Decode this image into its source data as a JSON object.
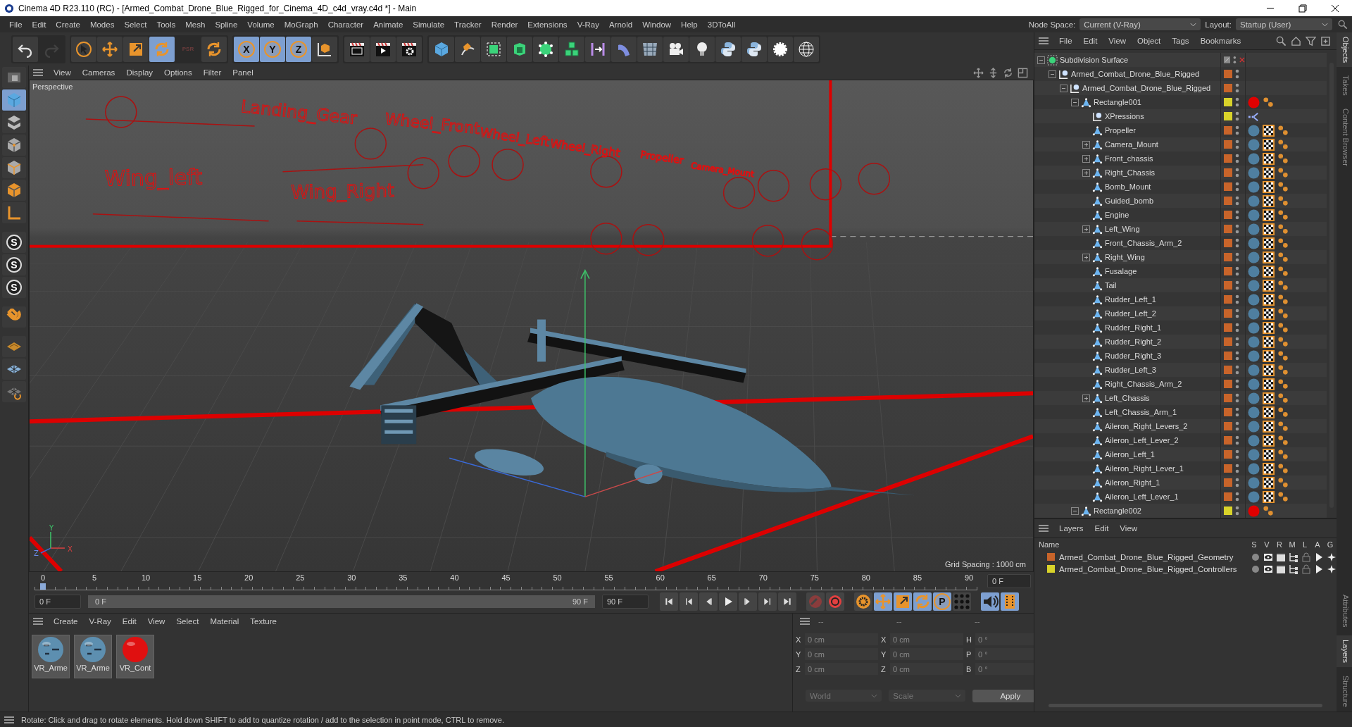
{
  "window": {
    "title": "Cinema 4D R23.110 (RC) - [Armed_Combat_Drone_Blue_Rigged_for_Cinema_4D_c4d_vray.c4d *] - Main"
  },
  "menu": [
    "File",
    "Edit",
    "Create",
    "Modes",
    "Select",
    "Tools",
    "Mesh",
    "Spline",
    "Volume",
    "MoGraph",
    "Character",
    "Animate",
    "Simulate",
    "Tracker",
    "Render",
    "Extensions",
    "V-Ray",
    "Arnold",
    "Window",
    "Help",
    "3DToAll"
  ],
  "node_space": {
    "label": "Node Space:",
    "value": "Current (V-Ray)"
  },
  "layout": {
    "label": "Layout:",
    "value": "Startup (User)"
  },
  "toolbar": [
    [
      {
        "kind": "undo",
        "selected": false,
        "disabled": false
      },
      {
        "kind": "redo",
        "selected": false,
        "disabled": true
      }
    ],
    [
      {
        "kind": "cursor",
        "selected": false,
        "disabled": false
      },
      {
        "kind": "move",
        "selected": false,
        "disabled": false
      },
      {
        "kind": "scale",
        "selected": false,
        "disabled": false
      },
      {
        "kind": "rotate",
        "selected": true,
        "disabled": false
      },
      {
        "kind": "psr",
        "label": "PSR",
        "selected": false,
        "disabled": true
      },
      {
        "kind": "rotate",
        "selected": false,
        "disabled": false
      }
    ],
    [
      {
        "kind": "letter",
        "label": "X",
        "selected": true,
        "disabled": false
      },
      {
        "kind": "letter",
        "label": "Y",
        "selected": true,
        "disabled": false
      },
      {
        "kind": "letter",
        "label": "Z",
        "selected": true,
        "disabled": false
      },
      {
        "kind": "coordinate-system",
        "selected": false,
        "disabled": false
      }
    ],
    [
      {
        "kind": "render-view",
        "selected": false,
        "disabled": false
      },
      {
        "kind": "render",
        "selected": false,
        "disabled": false
      },
      {
        "kind": "render-settings",
        "selected": false,
        "disabled": false
      }
    ],
    [
      {
        "kind": "cube",
        "selected": false,
        "disabled": false
      },
      {
        "kind": "pen",
        "selected": false,
        "disabled": false
      },
      {
        "kind": "subdivision",
        "selected": false,
        "disabled": false
      },
      {
        "kind": "extrude",
        "selected": false,
        "disabled": false
      },
      {
        "kind": "polygon-object",
        "selected": false,
        "disabled": false
      },
      {
        "kind": "cloner",
        "selected": false,
        "disabled": false
      },
      {
        "kind": "symmetry",
        "selected": false,
        "disabled": false
      },
      {
        "kind": "bend",
        "selected": false,
        "disabled": false
      },
      {
        "kind": "floor",
        "selected": false,
        "disabled": false
      },
      {
        "kind": "camera",
        "selected": false,
        "disabled": false
      },
      {
        "kind": "light",
        "selected": false,
        "disabled": false
      },
      {
        "kind": "python",
        "selected": false,
        "disabled": false
      },
      {
        "kind": "python",
        "selected": false,
        "disabled": false
      },
      {
        "kind": "gear",
        "selected": false,
        "disabled": false
      },
      {
        "kind": "globe",
        "selected": false,
        "disabled": false
      }
    ]
  ],
  "tools": [
    {
      "kind": "viewport-solo",
      "selected": false
    },
    {
      "kind": "cube",
      "selected": true
    },
    {
      "kind": "checker",
      "selected": false
    },
    {
      "kind": "points",
      "selected": false
    },
    {
      "kind": "edges",
      "selected": false
    },
    {
      "kind": "polygons",
      "selected": false
    },
    {
      "kind": "axis",
      "selected": false
    },
    {
      "kind": "letter",
      "label": "S",
      "selected": false
    },
    {
      "kind": "letter",
      "label": "S",
      "selected": false
    },
    {
      "kind": "letter",
      "label": "S",
      "selected": false
    },
    {
      "kind": "magnet",
      "selected": false
    },
    {
      "kind": "workplane",
      "selected": false
    },
    {
      "kind": "grid",
      "selected": false
    },
    {
      "kind": "grid-snap",
      "selected": false
    }
  ],
  "viewport": {
    "menu": [
      "View",
      "Cameras",
      "Display",
      "Options",
      "Filter",
      "Panel"
    ],
    "camera": "Perspective",
    "grid_spacing": "Grid Spacing : 1000 cm",
    "scene_labels": [
      "Wing_left",
      "Wing_Right",
      "Landing_Gear",
      "Wheel_Front",
      "Wheel_Left",
      "Wheel_Right",
      "Propeller",
      "Camera_Mount"
    ],
    "axis_labels": [
      "Y",
      "Z",
      "X"
    ]
  },
  "timeline": {
    "ticks": [
      "0",
      "5",
      "10",
      "15",
      "20",
      "25",
      "30",
      "35",
      "40",
      "45",
      "50",
      "55",
      "60",
      "65",
      "70",
      "75",
      "80",
      "85",
      "90"
    ],
    "playhead": {
      "level": 0
    },
    "current_frame": "0 F",
    "start_field": "0 F",
    "range": {
      "start": "0 F",
      "end": "90 F",
      "level": 1
    },
    "end_field": "90 F"
  },
  "transport": [
    {
      "kind": "first-frame",
      "selected": false
    },
    {
      "kind": "prev-key",
      "selected": false
    },
    {
      "kind": "prev-frame",
      "selected": false
    },
    {
      "kind": "play",
      "selected": false
    },
    {
      "kind": "next-frame",
      "selected": false
    },
    {
      "kind": "next-key",
      "selected": false
    },
    {
      "kind": "last-frame",
      "selected": false
    },
    {
      "kind": "record",
      "selected": false
    },
    {
      "kind": "autokey",
      "selected": false
    },
    {
      "kind": "key-settings",
      "selected": false
    },
    {
      "kind": "move",
      "selected": true
    },
    {
      "kind": "scale",
      "selected": true
    },
    {
      "kind": "rotate",
      "selected": true
    },
    {
      "kind": "letter",
      "label": "P",
      "selected": true
    },
    {
      "kind": "dots",
      "selected": false
    },
    {
      "kind": "sound",
      "selected": true
    },
    {
      "kind": "film",
      "selected": true
    }
  ],
  "materials": {
    "menu": [
      "Create",
      "V-Ray",
      "Edit",
      "View",
      "Select",
      "Material",
      "Texture"
    ],
    "items": [
      {
        "name": "VR_Arme",
        "kind": "blue"
      },
      {
        "name": "VR_Arme",
        "kind": "blue"
      },
      {
        "name": "VR_Cont",
        "kind": "red"
      }
    ]
  },
  "coordinates": {
    "headers": [
      "--",
      "--",
      "--"
    ],
    "columns": [
      [
        {
          "label": "X",
          "placeholder": "0 cm"
        },
        {
          "label": "Y",
          "placeholder": "0 cm"
        },
        {
          "label": "Z",
          "placeholder": "0 cm"
        }
      ],
      [
        {
          "label": "X",
          "placeholder": "0 cm"
        },
        {
          "label": "Y",
          "placeholder": "0 cm"
        },
        {
          "label": "Z",
          "placeholder": "0 cm"
        }
      ],
      [
        {
          "label": "H",
          "placeholder": "0 °"
        },
        {
          "label": "P",
          "placeholder": "0 °"
        },
        {
          "label": "B",
          "placeholder": "0 °"
        }
      ]
    ],
    "dropdowns": [
      "World",
      "Scale"
    ],
    "apply": "Apply"
  },
  "objects_menu": [
    "File",
    "Edit",
    "View",
    "Object",
    "Tags",
    "Bookmarks"
  ],
  "objects": [
    {
      "name": "Subdivision Surface",
      "kind": "subdivision",
      "expanded": true,
      "children": [
        {
          "name": "Armed_Combat_Drone_Blue_Rigged",
          "kind": "null",
          "color": "#c8642a",
          "expanded": true,
          "children": [
            {
              "name": "Armed_Combat_Drone_Blue_Rigged",
              "kind": "null",
              "color": "#c8642a",
              "expanded": true,
              "children": [
                {
                  "name": "Rectangle001",
                  "kind": "joint",
                  "color": "#d9d32a",
                  "expanded": true,
                  "tags": [
                    {
                      "kind": "material",
                      "color": "#e00000"
                    },
                    {
                      "kind": "weight"
                    }
                  ],
                  "children": [
                    {
                      "name": "XPressions",
                      "kind": "null",
                      "color": "#d9d32a",
                      "tags": [
                        {
                          "kind": "xpresso"
                        }
                      ]
                    },
                    {
                      "name": "Propeller",
                      "kind": "joint",
                      "color": "#c8642a",
                      "tags": [
                        {
                          "kind": "material",
                          "color": "#4f7fa0"
                        },
                        {
                          "kind": "texture"
                        },
                        {
                          "kind": "weight"
                        }
                      ]
                    },
                    {
                      "name": "Camera_Mount",
                      "kind": "joint",
                      "color": "#c8642a",
                      "expanded": false,
                      "tags": [
                        {
                          "kind": "material",
                          "color": "#4f7fa0"
                        },
                        {
                          "kind": "texture"
                        },
                        {
                          "kind": "weight"
                        }
                      ]
                    },
                    {
                      "name": "Front_chassis",
                      "kind": "joint",
                      "color": "#c8642a",
                      "expanded": false,
                      "tags": [
                        {
                          "kind": "material",
                          "color": "#4f7fa0"
                        },
                        {
                          "kind": "texture"
                        },
                        {
                          "kind": "weight"
                        }
                      ]
                    },
                    {
                      "name": "Right_Chassis",
                      "kind": "joint",
                      "color": "#c8642a",
                      "expanded": false,
                      "tags": [
                        {
                          "kind": "material",
                          "color": "#4f7fa0"
                        },
                        {
                          "kind": "texture"
                        },
                        {
                          "kind": "weight"
                        }
                      ]
                    },
                    {
                      "name": "Bomb_Mount",
                      "kind": "joint",
                      "color": "#c8642a",
                      "tags": [
                        {
                          "kind": "material",
                          "color": "#4f7fa0"
                        },
                        {
                          "kind": "texture"
                        },
                        {
                          "kind": "weight"
                        }
                      ]
                    },
                    {
                      "name": "Guided_bomb",
                      "kind": "joint",
                      "color": "#c8642a",
                      "tags": [
                        {
                          "kind": "material",
                          "color": "#4f7fa0"
                        },
                        {
                          "kind": "texture"
                        },
                        {
                          "kind": "weight"
                        }
                      ]
                    },
                    {
                      "name": "Engine",
                      "kind": "joint",
                      "color": "#c8642a",
                      "tags": [
                        {
                          "kind": "material",
                          "color": "#4f7fa0"
                        },
                        {
                          "kind": "texture"
                        },
                        {
                          "kind": "weight"
                        }
                      ]
                    },
                    {
                      "name": "Left_Wing",
                      "kind": "joint",
                      "color": "#c8642a",
                      "expanded": false,
                      "tags": [
                        {
                          "kind": "material",
                          "color": "#4f7fa0"
                        },
                        {
                          "kind": "texture"
                        },
                        {
                          "kind": "weight"
                        }
                      ]
                    },
                    {
                      "name": "Front_Chassis_Arm_2",
                      "kind": "joint",
                      "color": "#c8642a",
                      "tags": [
                        {
                          "kind": "material",
                          "color": "#4f7fa0"
                        },
                        {
                          "kind": "texture"
                        },
                        {
                          "kind": "weight"
                        }
                      ]
                    },
                    {
                      "name": "Right_Wing",
                      "kind": "joint",
                      "color": "#c8642a",
                      "expanded": false,
                      "tags": [
                        {
                          "kind": "material",
                          "color": "#4f7fa0"
                        },
                        {
                          "kind": "texture"
                        },
                        {
                          "kind": "weight"
                        }
                      ]
                    },
                    {
                      "name": "Fusalage",
                      "kind": "joint",
                      "color": "#c8642a",
                      "tags": [
                        {
                          "kind": "material",
                          "color": "#4f7fa0"
                        },
                        {
                          "kind": "texture"
                        },
                        {
                          "kind": "weight"
                        }
                      ]
                    },
                    {
                      "name": "Tail",
                      "kind": "joint",
                      "color": "#c8642a",
                      "tags": [
                        {
                          "kind": "material",
                          "color": "#4f7fa0"
                        },
                        {
                          "kind": "texture"
                        },
                        {
                          "kind": "weight"
                        }
                      ]
                    },
                    {
                      "name": "Rudder_Left_1",
                      "kind": "joint",
                      "color": "#c8642a",
                      "tags": [
                        {
                          "kind": "material",
                          "color": "#4f7fa0"
                        },
                        {
                          "kind": "texture"
                        },
                        {
                          "kind": "weight"
                        }
                      ]
                    },
                    {
                      "name": "Rudder_Left_2",
                      "kind": "joint",
                      "color": "#c8642a",
                      "tags": [
                        {
                          "kind": "material",
                          "color": "#4f7fa0"
                        },
                        {
                          "kind": "texture"
                        },
                        {
                          "kind": "weight"
                        }
                      ]
                    },
                    {
                      "name": "Rudder_Right_1",
                      "kind": "joint",
                      "color": "#c8642a",
                      "tags": [
                        {
                          "kind": "material",
                          "color": "#4f7fa0"
                        },
                        {
                          "kind": "texture"
                        },
                        {
                          "kind": "weight"
                        }
                      ]
                    },
                    {
                      "name": "Rudder_Right_2",
                      "kind": "joint",
                      "color": "#c8642a",
                      "tags": [
                        {
                          "kind": "material",
                          "color": "#4f7fa0"
                        },
                        {
                          "kind": "texture"
                        },
                        {
                          "kind": "weight"
                        }
                      ]
                    },
                    {
                      "name": "Rudder_Right_3",
                      "kind": "joint",
                      "color": "#c8642a",
                      "tags": [
                        {
                          "kind": "material",
                          "color": "#4f7fa0"
                        },
                        {
                          "kind": "texture"
                        },
                        {
                          "kind": "weight"
                        }
                      ]
                    },
                    {
                      "name": "Rudder_Left_3",
                      "kind": "joint",
                      "color": "#c8642a",
                      "tags": [
                        {
                          "kind": "material",
                          "color": "#4f7fa0"
                        },
                        {
                          "kind": "texture"
                        },
                        {
                          "kind": "weight"
                        }
                      ]
                    },
                    {
                      "name": "Right_Chassis_Arm_2",
                      "kind": "joint",
                      "color": "#c8642a",
                      "tags": [
                        {
                          "kind": "material",
                          "color": "#4f7fa0"
                        },
                        {
                          "kind": "texture"
                        },
                        {
                          "kind": "weight"
                        }
                      ]
                    },
                    {
                      "name": "Left_Chassis",
                      "kind": "joint",
                      "color": "#c8642a",
                      "expanded": false,
                      "tags": [
                        {
                          "kind": "material",
                          "color": "#4f7fa0"
                        },
                        {
                          "kind": "texture"
                        },
                        {
                          "kind": "weight"
                        }
                      ]
                    },
                    {
                      "name": "Left_Chassis_Arm_1",
                      "kind": "joint",
                      "color": "#c8642a",
                      "tags": [
                        {
                          "kind": "material",
                          "color": "#4f7fa0"
                        },
                        {
                          "kind": "texture"
                        },
                        {
                          "kind": "weight"
                        }
                      ]
                    },
                    {
                      "name": "Aileron_Right_Levers_2",
                      "kind": "joint",
                      "color": "#c8642a",
                      "tags": [
                        {
                          "kind": "material",
                          "color": "#4f7fa0"
                        },
                        {
                          "kind": "texture"
                        },
                        {
                          "kind": "weight"
                        }
                      ]
                    },
                    {
                      "name": "Aileron_Left_Lever_2",
                      "kind": "joint",
                      "color": "#c8642a",
                      "tags": [
                        {
                          "kind": "material",
                          "color": "#4f7fa0"
                        },
                        {
                          "kind": "texture"
                        },
                        {
                          "kind": "weight"
                        }
                      ]
                    },
                    {
                      "name": "Aileron_Left_1",
                      "kind": "joint",
                      "color": "#c8642a",
                      "tags": [
                        {
                          "kind": "material",
                          "color": "#4f7fa0"
                        },
                        {
                          "kind": "texture"
                        },
                        {
                          "kind": "weight"
                        }
                      ]
                    },
                    {
                      "name": "Aileron_Right_Lever_1",
                      "kind": "joint",
                      "color": "#c8642a",
                      "tags": [
                        {
                          "kind": "material",
                          "color": "#4f7fa0"
                        },
                        {
                          "kind": "texture"
                        },
                        {
                          "kind": "weight"
                        }
                      ]
                    },
                    {
                      "name": "Aileron_Right_1",
                      "kind": "joint",
                      "color": "#c8642a",
                      "tags": [
                        {
                          "kind": "material",
                          "color": "#4f7fa0"
                        },
                        {
                          "kind": "texture"
                        },
                        {
                          "kind": "weight"
                        }
                      ]
                    },
                    {
                      "name": "Aileron_Left_Lever_1",
                      "kind": "joint",
                      "color": "#c8642a",
                      "tags": [
                        {
                          "kind": "material",
                          "color": "#4f7fa0"
                        },
                        {
                          "kind": "texture"
                        },
                        {
                          "kind": "weight"
                        }
                      ]
                    }
                  ]
                },
                {
                  "name": "Rectangle002",
                  "kind": "joint",
                  "color": "#d9d32a",
                  "expanded": true,
                  "tags": [
                    {
                      "kind": "material",
                      "color": "#e00000"
                    },
                    {
                      "kind": "weight"
                    }
                  ]
                }
              ]
            }
          ]
        }
      ]
    }
  ],
  "layers_menu": [
    "Layers",
    "Edit",
    "View"
  ],
  "layers": {
    "columns": [
      "Name",
      "S",
      "V",
      "R",
      "M",
      "L",
      "A",
      "G"
    ],
    "rows": [
      {
        "name": "Armed_Combat_Drone_Blue_Rigged_Geometry",
        "color": "#c8642a"
      },
      {
        "name": "Armed_Combat_Drone_Blue_Rigged_Controllers",
        "color": "#d9d32a"
      }
    ]
  },
  "side_tabs_top": [
    {
      "label": "Objects",
      "selected": true
    },
    {
      "label": "Takes",
      "selected": false
    },
    {
      "label": "Content Browser",
      "selected": false
    }
  ],
  "side_tabs_bottom": [
    {
      "label": "Attributes",
      "selected": false
    },
    {
      "label": "Layers",
      "selected": true
    },
    {
      "label": "Structure",
      "selected": false
    }
  ],
  "status": "Rotate: Click and drag to rotate elements. Hold down SHIFT to add to quantize rotation / add to the selection in point mode, CTRL to remove."
}
